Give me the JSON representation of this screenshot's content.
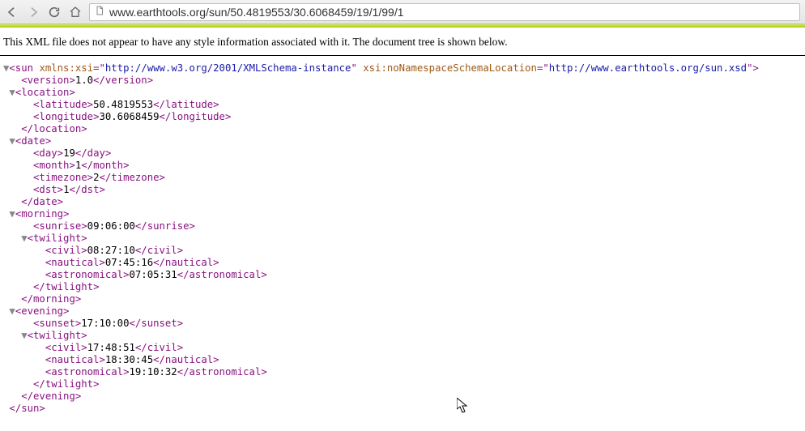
{
  "browser": {
    "url": "www.earthtools.org/sun/50.4819553/30.6068459/19/1/99/1"
  },
  "info_message": "This XML file does not appear to have any style information associated with it. The document tree is shown below.",
  "xml": {
    "root_tag": "sun",
    "xmlns_xsi_attr": "xmlns:xsi",
    "xmlns_xsi_val": "http://www.w3.org/2001/XMLSchema-instance",
    "schemaLoc_attr": "xsi:noNamespaceSchemaLocation",
    "schemaLoc_val": "http://www.earthtools.org/sun.xsd",
    "version": "1.0",
    "location": {
      "latitude": "50.4819553",
      "longitude": "30.6068459"
    },
    "date": {
      "day": "19",
      "month": "1",
      "timezone": "2",
      "dst": "1"
    },
    "morning": {
      "sunrise": "09:06:00",
      "twilight": {
        "civil": "08:27:10",
        "nautical": "07:45:16",
        "astronomical": "07:05:31"
      }
    },
    "evening": {
      "sunset": "17:10:00",
      "twilight": {
        "civil": "17:48:51",
        "nautical": "18:30:45",
        "astronomical": "19:10:32"
      }
    }
  }
}
